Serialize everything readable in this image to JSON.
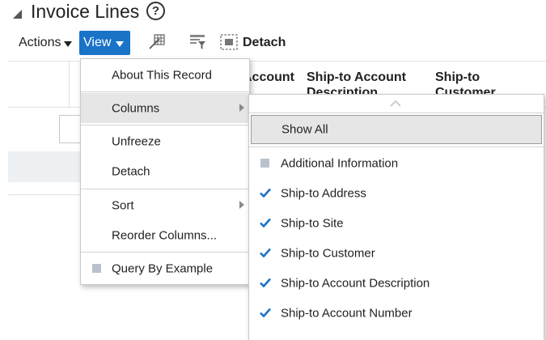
{
  "header": {
    "title": "Invoice Lines",
    "help_glyph": "?"
  },
  "toolbar": {
    "actions_label": "Actions",
    "view_label": "View",
    "detach_label": "Detach"
  },
  "table": {
    "headers": [
      {
        "text": "Account"
      },
      {
        "text": "Ship-to Account Description"
      },
      {
        "text": "Ship-to Customer"
      }
    ]
  },
  "view_menu": {
    "items": [
      {
        "label": "About This Record"
      },
      {
        "label": "Columns",
        "has_submenu": true,
        "highlighted": true
      },
      {
        "label": "Unfreeze"
      },
      {
        "label": "Detach"
      },
      {
        "label": "Sort",
        "has_submenu": true
      },
      {
        "label": "Reorder Columns..."
      },
      {
        "label": "Query By Example",
        "icon": "square-icon"
      }
    ]
  },
  "columns_menu": {
    "items": [
      {
        "label": "Show All",
        "highlighted": true
      },
      {
        "label": "Additional Information",
        "state": "unchecked"
      },
      {
        "label": "Ship-to Address",
        "state": "checked"
      },
      {
        "label": "Ship-to Site",
        "state": "checked"
      },
      {
        "label": "Ship-to Customer",
        "state": "checked"
      },
      {
        "label": "Ship-to Account Description",
        "state": "checked"
      },
      {
        "label": "Ship-to Account Number",
        "state": "checked"
      }
    ]
  },
  "colors": {
    "accent": "#1a73c7",
    "highlight": "#e6e6e6",
    "check": "#1a73c7"
  }
}
